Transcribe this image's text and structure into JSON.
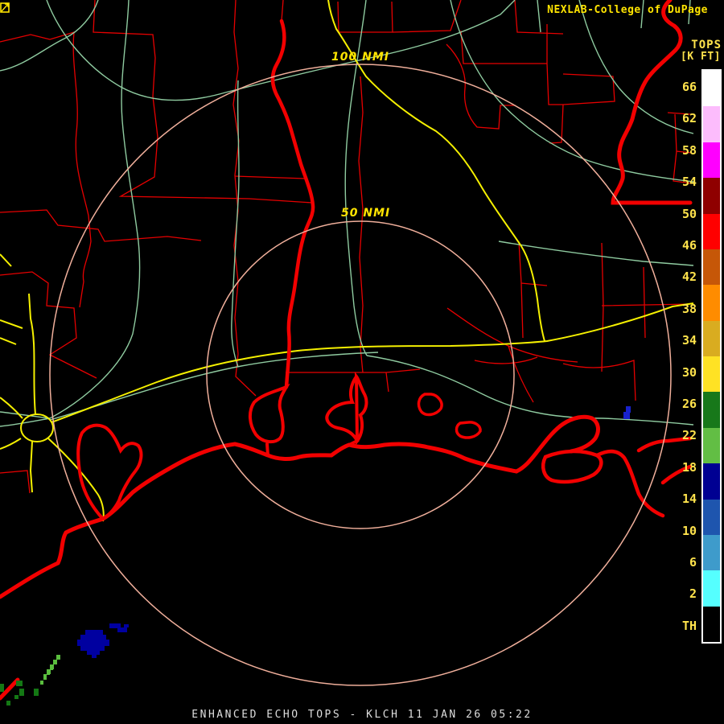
{
  "header": {
    "brand": "NEXLAB-College of DuPage",
    "brand_color": "#FFE400",
    "logo_icon": "college-of-dupage-logo-icon"
  },
  "rings": [
    {
      "label": "100 NMI",
      "radius_px": 386
    },
    {
      "label": "50 NMI",
      "radius_px": 191
    }
  ],
  "legend": {
    "title": "TOPS",
    "units": "[K FT]",
    "labels": [
      "66",
      "62",
      "58",
      "54",
      "50",
      "46",
      "42",
      "38",
      "34",
      "30",
      "26",
      "22",
      "18",
      "14",
      "10",
      "6",
      "2",
      "TH"
    ],
    "segments": [
      {
        "name": "white",
        "color": "#FFFFFF"
      },
      {
        "name": "pale-pink",
        "color": "#FCBCFC"
      },
      {
        "name": "magenta",
        "color": "#FF00FF"
      },
      {
        "name": "dark-red",
        "color": "#8F0000"
      },
      {
        "name": "red",
        "color": "#FF0000"
      },
      {
        "name": "red-orange",
        "color": "#C65708"
      },
      {
        "name": "orange",
        "color": "#FF8C00"
      },
      {
        "name": "gold",
        "color": "#D9AC20"
      },
      {
        "name": "yellow",
        "color": "#FFE224"
      },
      {
        "name": "dark-green",
        "color": "#17781A"
      },
      {
        "name": "green",
        "color": "#62BE44"
      },
      {
        "name": "navy",
        "color": "#000092"
      },
      {
        "name": "blue",
        "color": "#1E55AE"
      },
      {
        "name": "steel-blue",
        "color": "#3E9BCB"
      },
      {
        "name": "cyan",
        "color": "#55FFFF"
      },
      {
        "name": "black",
        "color": "#000000"
      }
    ]
  },
  "echoes": [
    {
      "name": "echo-navy-cluster",
      "color": "#0000A0",
      "rects": [
        [
          106,
          783,
          22,
          8
        ],
        [
          100,
          789,
          32,
          9
        ],
        [
          96,
          795,
          40,
          8
        ],
        [
          100,
          803,
          30,
          6
        ],
        [
          108,
          809,
          16,
          5
        ],
        [
          114,
          814,
          6,
          4
        ],
        [
          136,
          775,
          14,
          6
        ],
        [
          146,
          780,
          12,
          6
        ],
        [
          154,
          776,
          6,
          4
        ]
      ]
    },
    {
      "name": "echo-light-green-streaks",
      "color": "#5ABE3E",
      "rects": [
        [
          70,
          814,
          5,
          6
        ],
        [
          66,
          820,
          5,
          6
        ],
        [
          62,
          826,
          5,
          6
        ],
        [
          58,
          832,
          5,
          6
        ],
        [
          54,
          838,
          4,
          5
        ],
        [
          62,
          828,
          4,
          5
        ],
        [
          58,
          834,
          4,
          5
        ],
        [
          54,
          840,
          4,
          5
        ],
        [
          50,
          846,
          4,
          5
        ]
      ]
    },
    {
      "name": "echo-dark-green-bits",
      "color": "#147814",
      "rects": [
        [
          20,
          846,
          8,
          7
        ],
        [
          24,
          856,
          6,
          9
        ],
        [
          18,
          864,
          5,
          5
        ],
        [
          0,
          850,
          5,
          10
        ],
        [
          42,
          856,
          6,
          9
        ],
        [
          8,
          871,
          5,
          6
        ]
      ]
    },
    {
      "name": "echo-blue-cell",
      "color": "#1822CC",
      "rects": [
        [
          778,
          505,
          6,
          8
        ],
        [
          775,
          512,
          8,
          9
        ]
      ]
    }
  ],
  "footer": {
    "caption": "ENHANCED ECHO TOPS - KLCH 11 JAN 26 05:22"
  }
}
